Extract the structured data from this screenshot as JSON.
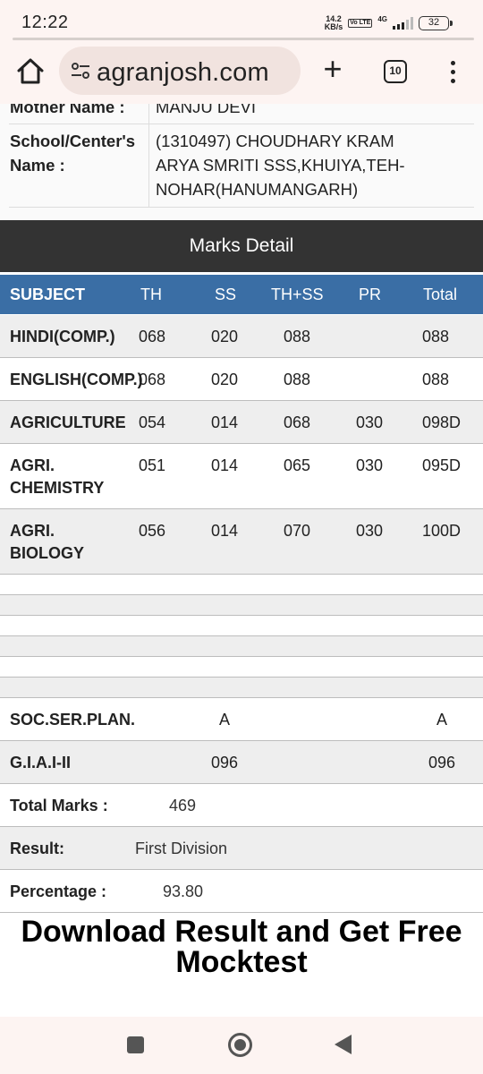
{
  "status_bar": {
    "time": "12:22",
    "net_speed_value": "14.2",
    "net_speed_unit": "KB/s",
    "volte": "Vo LTE",
    "network": "4G",
    "battery": "32"
  },
  "browser": {
    "url": "agranjosh.com",
    "tab_count": "10",
    "new_tab_label": "+"
  },
  "student_info": {
    "mother_name_label": "Mother Name :",
    "mother_name_value": "MANJU DEVI",
    "school_label_line1": "School/Center's",
    "school_label_line2": "Name :",
    "school_value_line1": "(1310497) CHOUDHARY KRAM",
    "school_value_line2": "ARYA SMRITI SSS,KHUIYA,TEH-",
    "school_value_line3": "NOHAR(HANUMANGARH)"
  },
  "marks": {
    "section_title": "Marks Detail",
    "columns": [
      "SUBJECT",
      "TH",
      "SS",
      "TH+SS",
      "PR",
      "Total"
    ],
    "rows": [
      {
        "subject": "HINDI(COMP.)",
        "subject2": "",
        "th": "068",
        "ss": "020",
        "thss": "088",
        "pr": "",
        "total": "088"
      },
      {
        "subject": "ENGLISH(COMP.)",
        "subject2": "",
        "th": "068",
        "ss": "020",
        "thss": "088",
        "pr": "",
        "total": "088"
      },
      {
        "subject": "AGRICULTURE",
        "subject2": "",
        "th": "054",
        "ss": "014",
        "thss": "068",
        "pr": "030",
        "total": "098D"
      },
      {
        "subject": "AGRI.",
        "subject2": "CHEMISTRY",
        "th": "051",
        "ss": "014",
        "thss": "065",
        "pr": "030",
        "total": "095D"
      },
      {
        "subject": "AGRI.",
        "subject2": "BIOLOGY",
        "th": "056",
        "ss": "014",
        "thss": "070",
        "pr": "030",
        "total": "100D"
      }
    ],
    "extra_rows": [
      {
        "subject": "SOC.SER.PLAN.",
        "ss": "A",
        "total": "A"
      },
      {
        "subject": "G.I.A.I-II",
        "ss": "096",
        "total": "096"
      }
    ]
  },
  "summary": {
    "total_label": "Total Marks :",
    "total_value": "469",
    "result_label": "Result:",
    "result_value": "First Division",
    "percentage_label": "Percentage :",
    "percentage_value": "93.80"
  },
  "cta": {
    "line1": "Download Result and Get Free",
    "line2": "Mocktest"
  },
  "colors": {
    "table_header_bg": "#3a6ea5",
    "section_header_bg": "#333333",
    "row_alt_bg": "#eeeeee"
  }
}
